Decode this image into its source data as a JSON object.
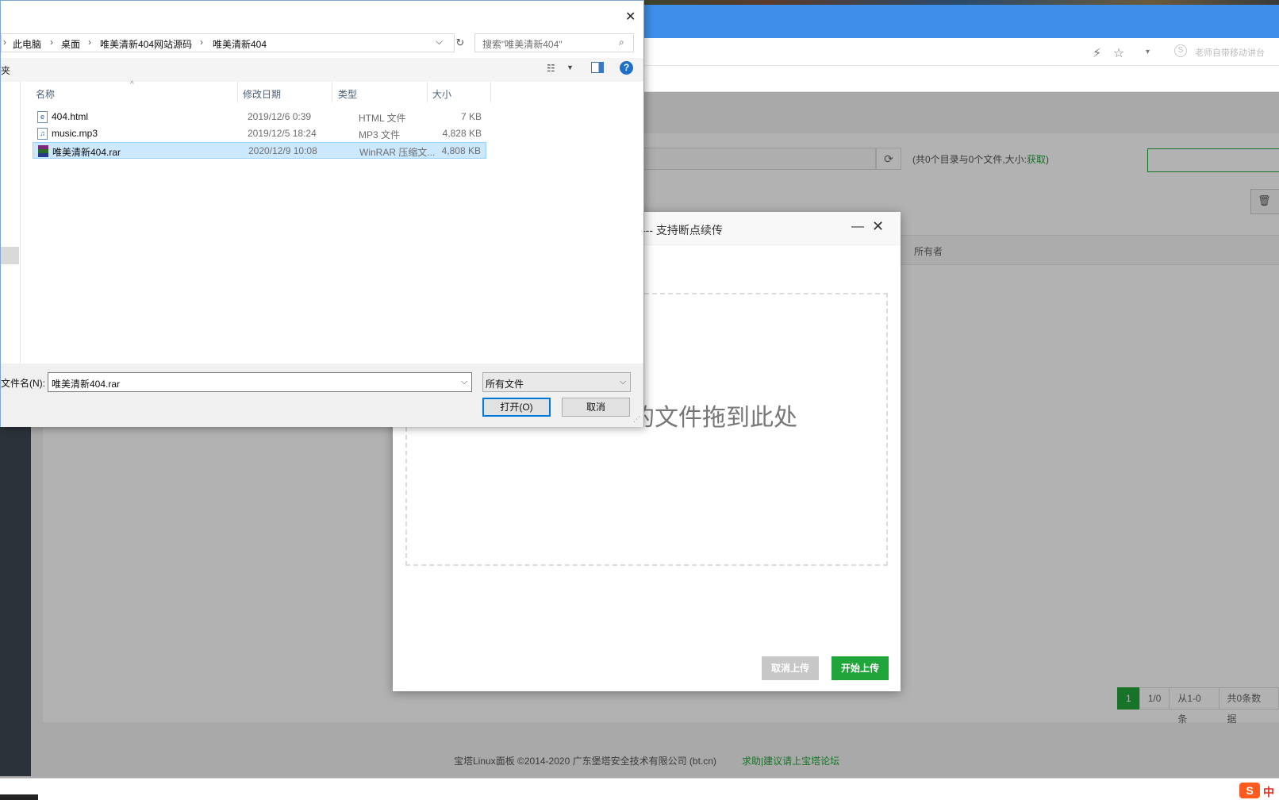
{
  "browser": {
    "extra_label": "老师自带移动讲台"
  },
  "page": {
    "dir_summary_prefix": "(共0个目录与0个文件,大小:",
    "dir_summary_fetch": "获取",
    "dir_summary_suffix": ")",
    "owner_column": "所有者",
    "pager": {
      "current": "1",
      "pages": "1/0",
      "range": "从1-0条",
      "total": "共0条数据"
    },
    "footer_text": "宝塔Linux面板 ©2014-2020 广东堡塔安全技术有限公司 (bt.cn)",
    "footer_link": "求助|建议请上宝塔论坛"
  },
  "upload_modal": {
    "title": "】--- 支持断点续传",
    "drop_text": "的文件拖到此处",
    "cancel_label": "取消上传",
    "start_label": "开始上传"
  },
  "file_dialog": {
    "breadcrumbs": [
      "此电脑",
      "桌面",
      "唯美清新404网站源码",
      "唯美清新404"
    ],
    "search_placeholder": "搜索\"唯美清新404\"",
    "folder_label": "夹",
    "columns": {
      "name": "名称",
      "date": "修改日期",
      "type": "类型",
      "size": "大小"
    },
    "files": [
      {
        "name": "404.html",
        "date": "2019/12/6 0:39",
        "type": "HTML 文件",
        "size": "7 KB",
        "icon": "html-file-icon",
        "selected": false
      },
      {
        "name": "music.mp3",
        "date": "2019/12/5 18:24",
        "type": "MP3 文件",
        "size": "4,828 KB",
        "icon": "audio-file-icon",
        "selected": false
      },
      {
        "name": "唯美清新404.rar",
        "date": "2020/12/9 10:08",
        "type": "WinRAR 压缩文...",
        "size": "4,808 KB",
        "icon": "rar-archive-icon",
        "selected": true
      }
    ],
    "filename_label": "文件名(N):",
    "filename_value": "唯美清新404.rar",
    "filetype_value": "所有文件",
    "open_label": "打开(O)",
    "cancel_label": "取消"
  },
  "colors": {
    "accent_green": "#20a53a",
    "browser_blue": "#3d8fe9",
    "win_selection": "#cce8ff",
    "win_focus": "#0078d7"
  }
}
